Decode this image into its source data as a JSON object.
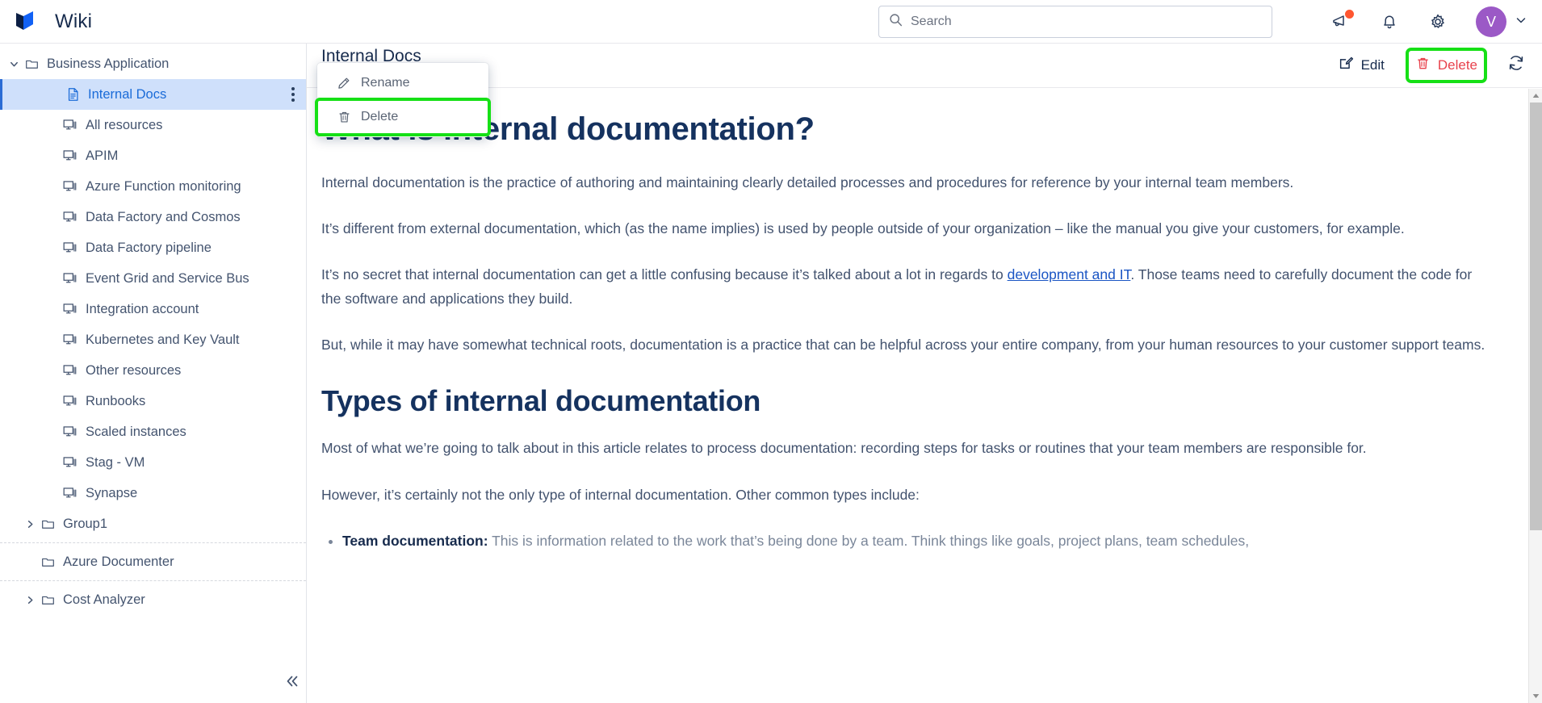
{
  "app": {
    "title": "Wiki",
    "logo_icon": "wiki-logo-icon"
  },
  "search": {
    "placeholder": "Search",
    "value": "",
    "icon": "search-icon"
  },
  "top_icons": [
    {
      "name": "announcement-icon",
      "badge": true
    },
    {
      "name": "notifications-bell-icon",
      "badge": false
    },
    {
      "name": "settings-gear-icon",
      "badge": false
    }
  ],
  "user": {
    "initial": "V",
    "avatar_color": "#9b59c6",
    "chevron_icon": "chevron-down-icon"
  },
  "sidebar": {
    "groups": [
      {
        "items": [
          {
            "label": "Business Application",
            "icon": "folder-icon",
            "level": "root",
            "caret": "down",
            "selected": false
          },
          {
            "label": "Internal Docs",
            "icon": "document-icon",
            "level": "child",
            "caret": "none",
            "selected": true,
            "has_menu": true
          },
          {
            "label": "All resources",
            "icon": "resource-icon",
            "level": "child",
            "caret": "none",
            "selected": false
          },
          {
            "label": "APIM",
            "icon": "resource-icon",
            "level": "child",
            "caret": "none",
            "selected": false
          },
          {
            "label": "Azure Function monitoring",
            "icon": "resource-icon",
            "level": "child",
            "caret": "none",
            "selected": false
          },
          {
            "label": "Data Factory and Cosmos",
            "icon": "resource-icon",
            "level": "child",
            "caret": "none",
            "selected": false
          },
          {
            "label": "Data Factory pipeline",
            "icon": "resource-icon",
            "level": "child",
            "caret": "none",
            "selected": false
          },
          {
            "label": "Event Grid and Service Bus",
            "icon": "resource-icon",
            "level": "child",
            "caret": "none",
            "selected": false
          },
          {
            "label": "Integration account",
            "icon": "resource-icon",
            "level": "child",
            "caret": "none",
            "selected": false
          },
          {
            "label": "Kubernetes and Key Vault",
            "icon": "resource-icon",
            "level": "child",
            "caret": "none",
            "selected": false
          },
          {
            "label": "Other resources",
            "icon": "resource-icon",
            "level": "child",
            "caret": "none",
            "selected": false
          },
          {
            "label": "Runbooks",
            "icon": "resource-icon",
            "level": "child",
            "caret": "none",
            "selected": false
          },
          {
            "label": "Scaled instances",
            "icon": "resource-icon",
            "level": "child",
            "caret": "none",
            "selected": false
          },
          {
            "label": "Stag - VM",
            "icon": "resource-icon",
            "level": "child",
            "caret": "none",
            "selected": false
          },
          {
            "label": "Synapse",
            "icon": "resource-icon",
            "level": "child",
            "caret": "none",
            "selected": false
          },
          {
            "label": "Group1",
            "icon": "folder-icon",
            "level": "group",
            "caret": "right",
            "selected": false
          }
        ]
      },
      {
        "items": [
          {
            "label": "Azure Documenter",
            "icon": "folder-icon",
            "level": "flat",
            "caret": "none",
            "selected": false
          }
        ]
      },
      {
        "items": [
          {
            "label": "Cost Analyzer",
            "icon": "folder-icon",
            "level": "group",
            "caret": "right",
            "selected": false
          }
        ]
      }
    ],
    "collapse_icon": "double-chevron-left-icon"
  },
  "context_menu": {
    "items": [
      {
        "label": "Rename",
        "icon": "pencil-icon",
        "highlighted": false
      },
      {
        "label": "Delete",
        "icon": "trash-icon",
        "highlighted": true
      }
    ],
    "highlight_color": "#16e016"
  },
  "document": {
    "title": "Internal Docs",
    "actions": [
      {
        "label": "Edit",
        "icon": "edit-pencil-icon",
        "danger": false,
        "highlighted": false
      },
      {
        "label": "Delete",
        "icon": "trash-icon",
        "danger": true,
        "highlighted": true
      },
      {
        "label": "",
        "icon": "refresh-sync-icon",
        "danger": false,
        "highlighted": false
      }
    ],
    "heading1": "What is internal documentation?",
    "paragraph1": "Internal documentation is the practice of authoring and maintaining clearly detailed processes and procedures for reference by your internal team members.",
    "paragraph2": "It’s different from external documentation, which (as the name implies) is used by people outside of your organization – like the manual you give your customers, for example.",
    "paragraph3_pre": "It’s no secret that internal documentation can get a little confusing because it’s talked about a lot in regards to ",
    "paragraph3_link": "development and IT",
    "paragraph3_post": ". Those teams need to carefully document the code for the software and applications they build.",
    "paragraph4": "But, while it may have somewhat technical roots, documentation is a practice that can be helpful across your entire company, from your human resources to your customer support teams.",
    "heading2": "Types of internal documentation",
    "paragraph5": "Most of what we’re going to talk about in this article relates to process documentation: recording steps for tasks or routines that your team members are responsible for.",
    "paragraph6": "However, it’s certainly not the only type of internal documentation. Other common types include:",
    "bullet1_bold": "Team documentation:",
    "bullet1_text": " This is information related to the work that’s being done by a team. Think things like goals, project plans, team schedules,"
  },
  "colors": {
    "link": "#1a55c4",
    "heading": "#15325f",
    "danger": "#e8424c",
    "selected_bg": "#cfe0fb",
    "highlight": "#16e016"
  }
}
